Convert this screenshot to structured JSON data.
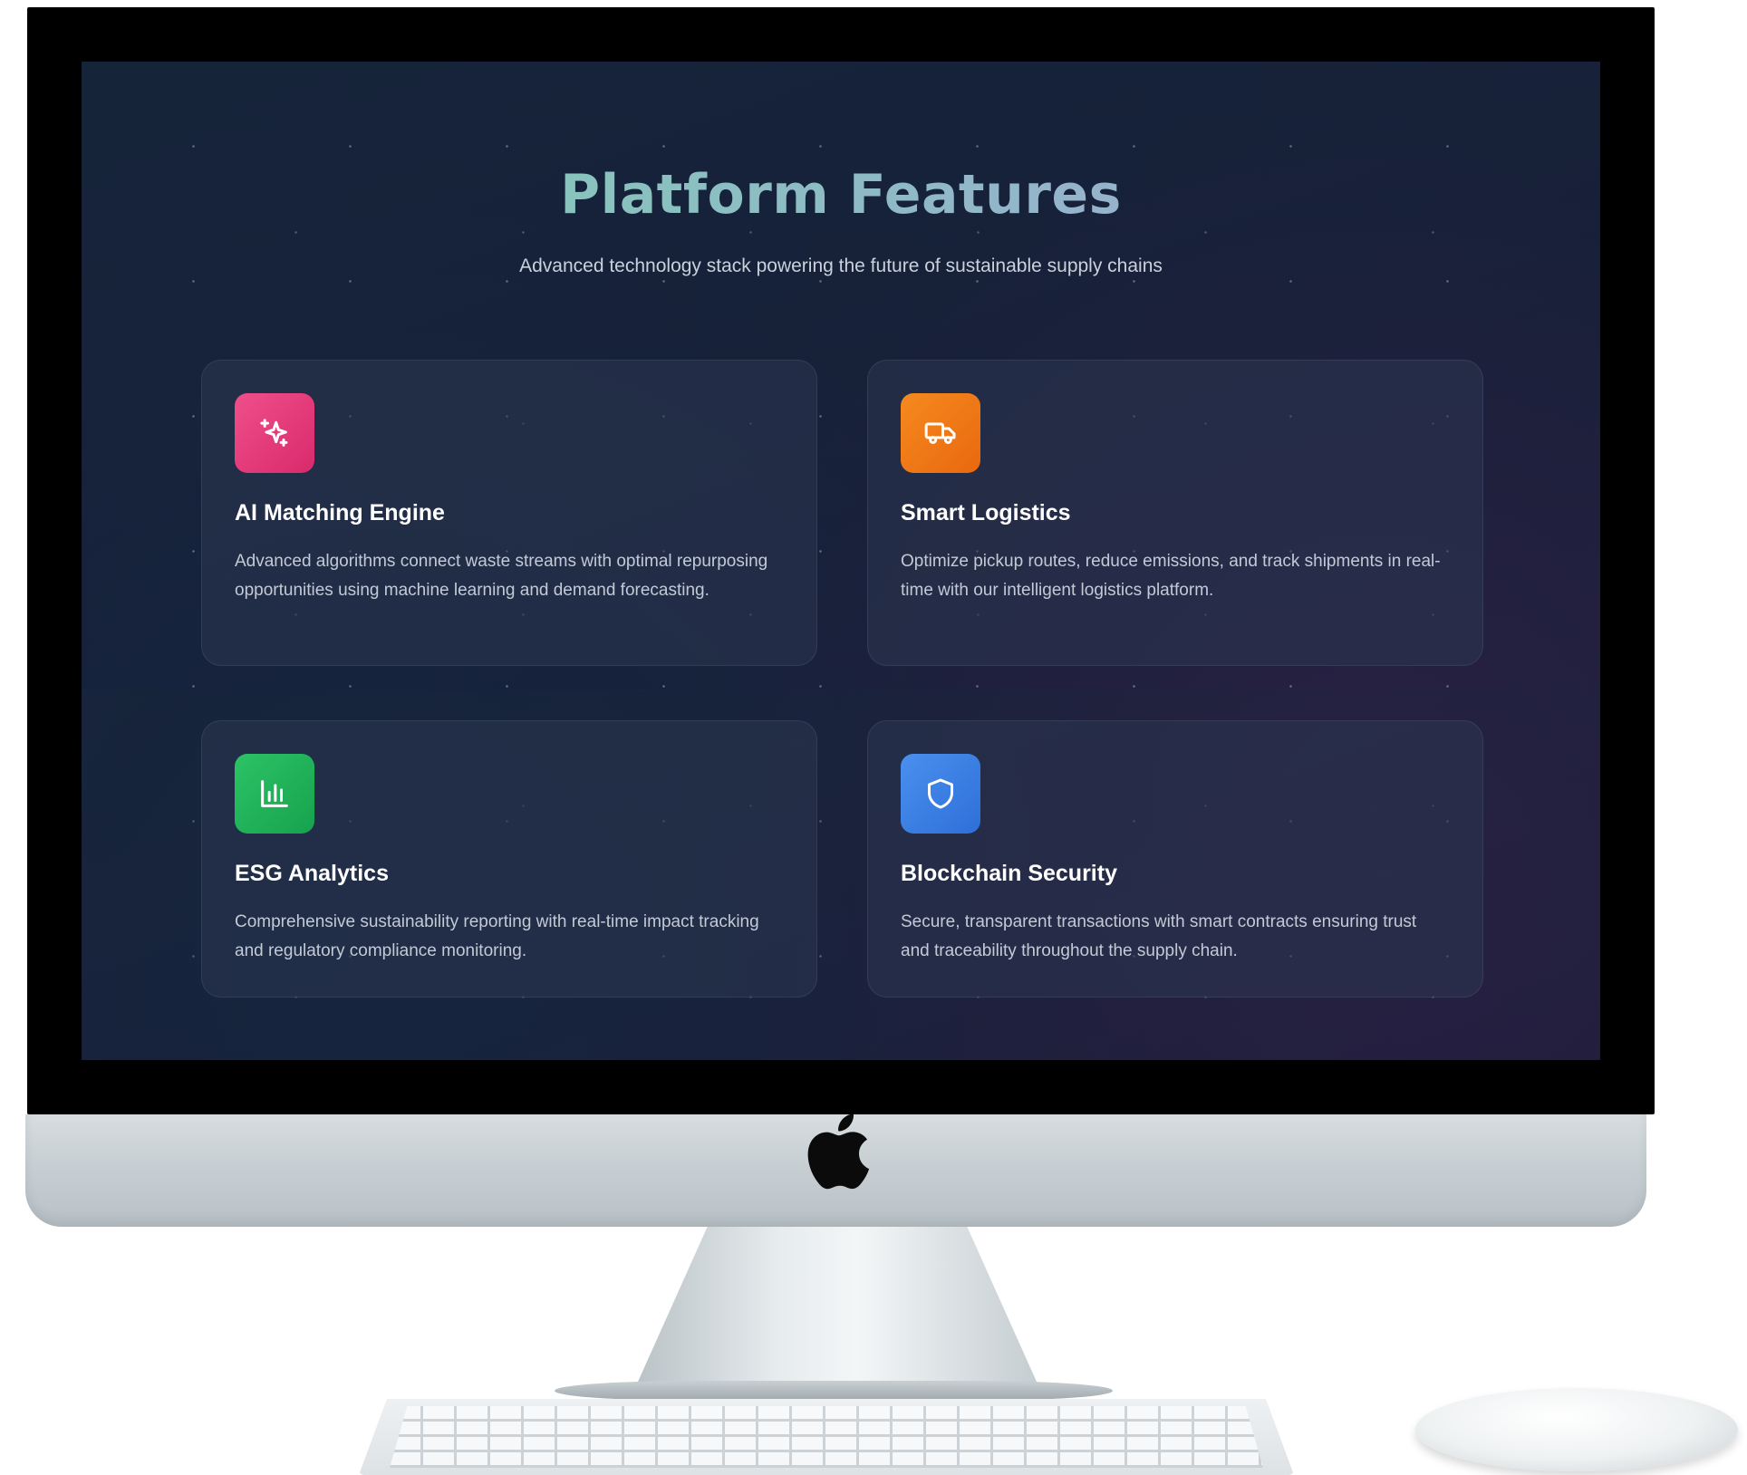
{
  "header": {
    "title": "Platform Features",
    "subtitle": "Advanced technology stack powering the future of sustainable supply chains"
  },
  "features": [
    {
      "icon": "sparkles-icon",
      "color": "#e63b7a",
      "title": "AI Matching Engine",
      "description": "Advanced algorithms connect waste streams with optimal repurposing opportunities using machine learning and demand forecasting."
    },
    {
      "icon": "truck-icon",
      "color": "#f07a16",
      "title": "Smart Logistics",
      "description": "Optimize pickup routes, reduce emissions, and track shipments in real-time with our intelligent logistics platform."
    },
    {
      "icon": "bar-chart-icon",
      "color": "#22b45a",
      "title": "ESG Analytics",
      "description": "Comprehensive sustainability reporting with real-time impact tracking and regulatory compliance monitoring."
    },
    {
      "icon": "shield-icon",
      "color": "#3a7fe6",
      "title": "Blockchain Security",
      "description": "Secure, transparent transactions with smart contracts ensuring trust and traceability throughout the supply chain."
    }
  ],
  "theme": {
    "background": "#172038",
    "title_gradient": [
      "#7fd1b0",
      "#a8a3da"
    ]
  }
}
